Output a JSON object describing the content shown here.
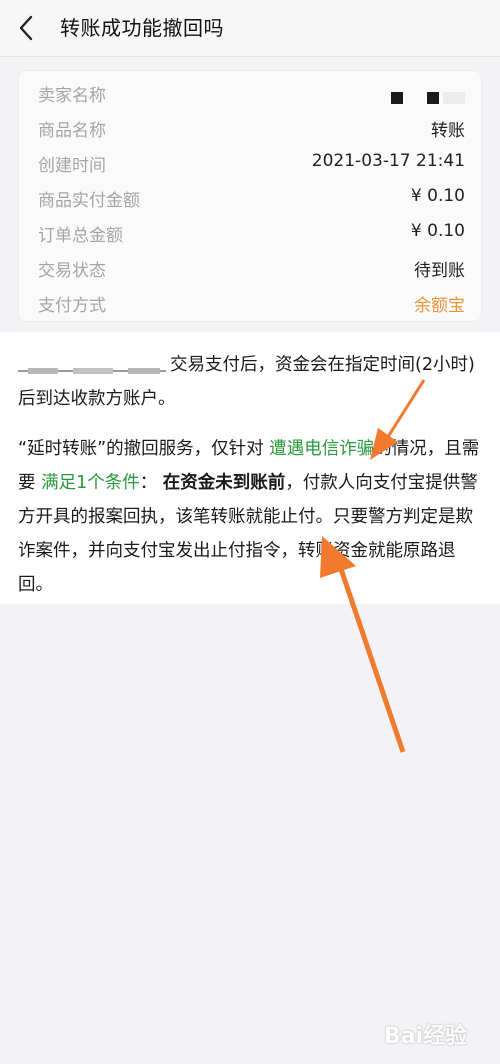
{
  "header": {
    "title": "转账成功能撤回吗",
    "back_icon": "chevron-left-icon"
  },
  "order": {
    "rows": [
      {
        "label": "卖家名称",
        "value": ""
      },
      {
        "label": "商品名称",
        "value": "转账"
      },
      {
        "label": "创建时间",
        "value": "2021-03-17 21:41"
      },
      {
        "label": "商品实付金额",
        "value": "¥ 0.10"
      },
      {
        "label": "订单总金额",
        "value": "¥ 0.10"
      },
      {
        "label": "交易状态",
        "value": "待到账"
      },
      {
        "label": "支付方式",
        "value": "余额宝"
      }
    ],
    "payment_color": "#e8963a"
  },
  "article": {
    "p1_text": "交易支付后，资金会在指定时间(2小时)后到达收款方账户。",
    "p2_a": "“延时转账”的撤回服务，仅针对",
    "p2_green1": "遭遇电信诈骗",
    "p2_b": "的情况，且需要",
    "p2_green2": "满足1个条件",
    "p2_c": "：",
    "p2_bold": "在资金未到账前",
    "p2_d": "，付款人向支付宝提供警方开具的报案回执，该笔转账就能止付。只要警方判定是欺诈案件，并向支付宝发出止付指令，转账资金就能原路退回。",
    "highlight_color": "#2a9a3c",
    "arrow_color": "#f07b2e"
  },
  "watermark": {
    "text": "Bai经验"
  }
}
